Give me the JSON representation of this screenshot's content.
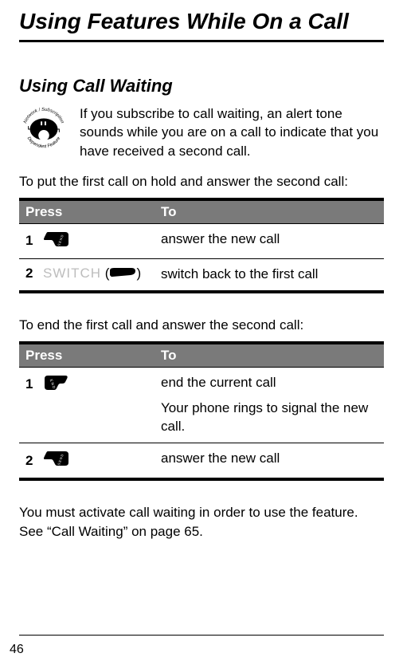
{
  "title": "Using Features While On a Call",
  "section_heading": "Using Call Waiting",
  "intro": "If you subscribe to call waiting, an alert tone sounds while you are on a call to indicate that you have received a second call.",
  "lead1": "To put the first call on hold and answer the second call:",
  "table1": {
    "header_press": "Press",
    "header_to": "To",
    "rows": [
      {
        "num": "1",
        "to": "answer the new call"
      },
      {
        "num": "2",
        "switch_label": "SWITCH",
        "to": "switch back to the first call"
      }
    ]
  },
  "lead2": "To end the first call and answer the second call:",
  "table2": {
    "header_press": "Press",
    "header_to": "To",
    "rows": [
      {
        "num": "1",
        "to": "end the current call",
        "secondary": "Your phone rings to signal the new call."
      },
      {
        "num": "2",
        "to": "answer the new call"
      }
    ]
  },
  "closing": "You must activate call waiting in order to use the feature. See “Call Waiting” on page 65.",
  "page_number": "46"
}
